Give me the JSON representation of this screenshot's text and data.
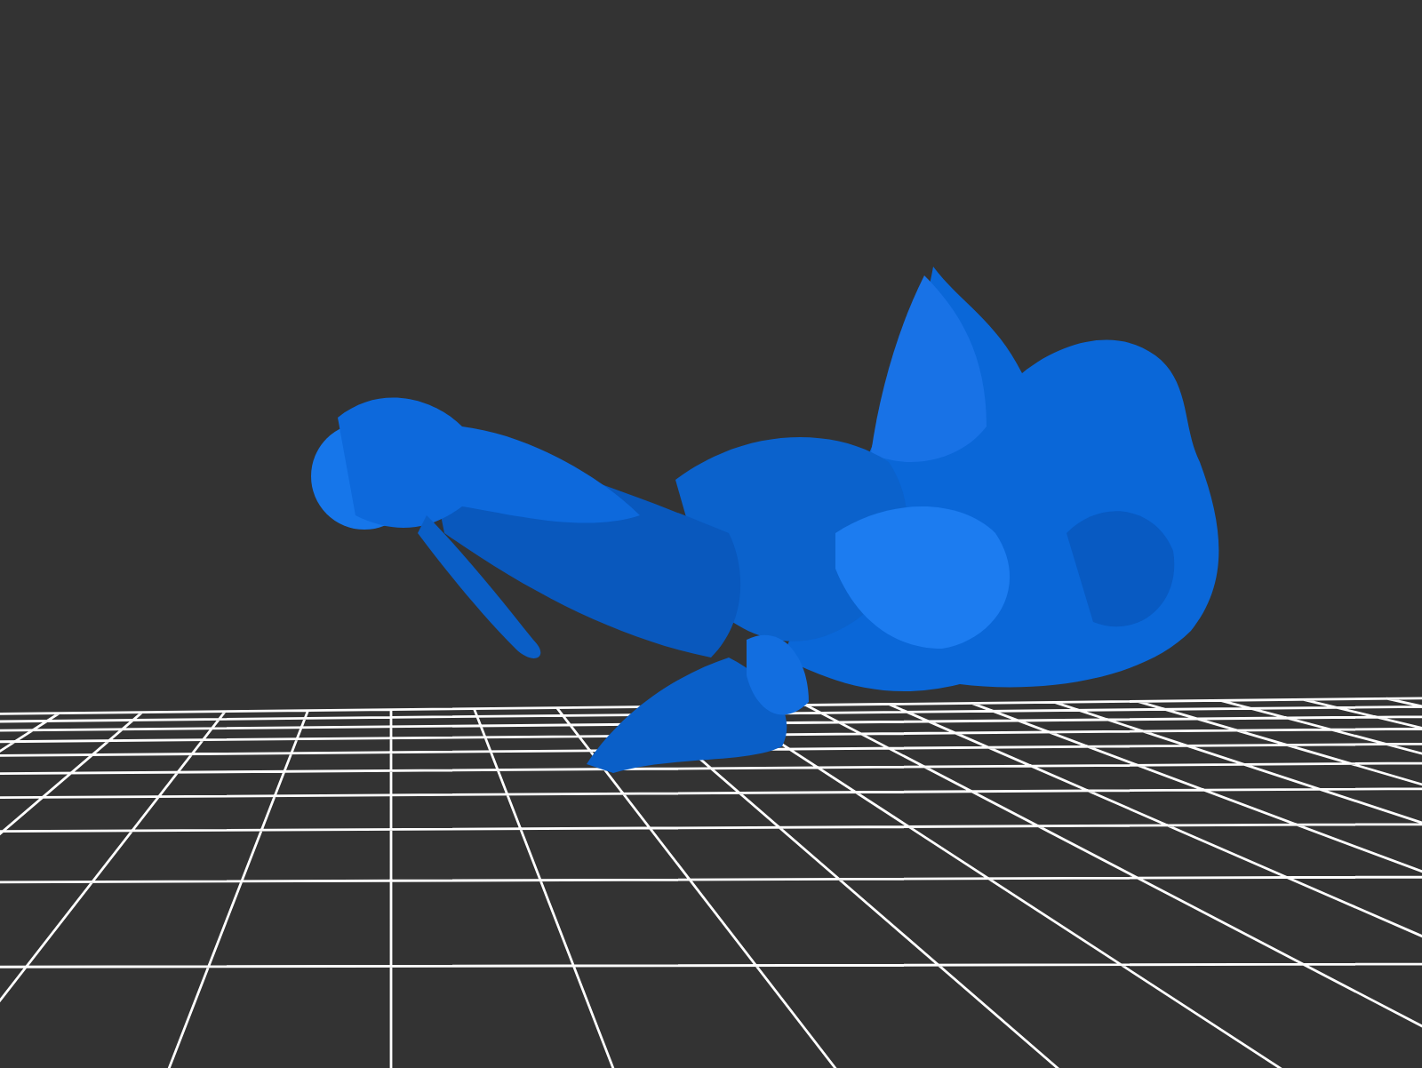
{
  "viewport": {
    "grid": true,
    "model": true
  }
}
